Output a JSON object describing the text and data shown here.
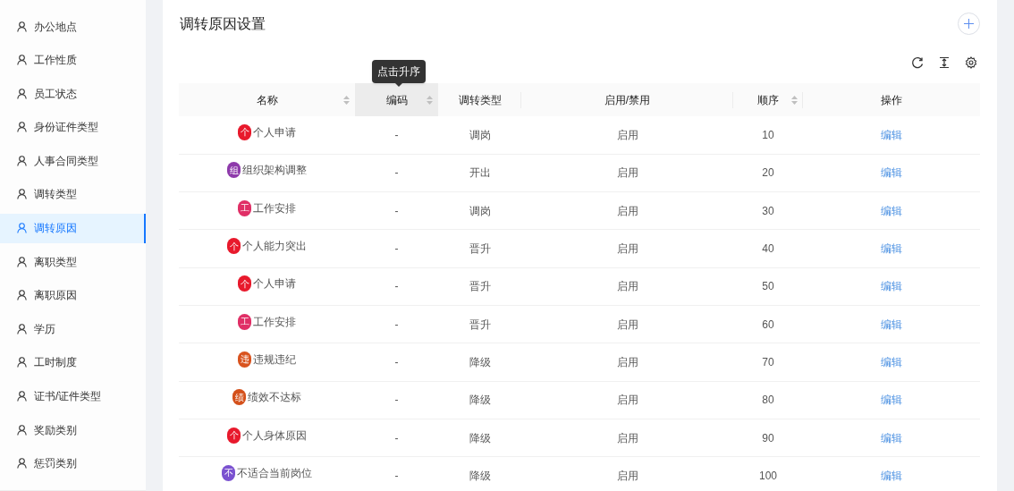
{
  "sidebar": {
    "items": [
      {
        "label": "办公地点",
        "selected": false
      },
      {
        "label": "工作性质",
        "selected": false
      },
      {
        "label": "员工状态",
        "selected": false
      },
      {
        "label": "身份证件类型",
        "selected": false
      },
      {
        "label": "人事合同类型",
        "selected": false
      },
      {
        "label": "调转类型",
        "selected": false
      },
      {
        "label": "调转原因",
        "selected": true
      },
      {
        "label": "离职类型",
        "selected": false
      },
      {
        "label": "离职原因",
        "selected": false
      },
      {
        "label": "学历",
        "selected": false
      },
      {
        "label": "工时制度",
        "selected": false
      },
      {
        "label": "证书/证件类型",
        "selected": false
      },
      {
        "label": "奖励类别",
        "selected": false
      },
      {
        "label": "惩罚类别",
        "selected": false
      }
    ]
  },
  "page": {
    "title": "调转原因设置",
    "tooltip": "点击升序"
  },
  "table": {
    "columns": [
      {
        "label": "名称",
        "sortable": true,
        "highlighted": false
      },
      {
        "label": "编码",
        "sortable": true,
        "highlighted": true
      },
      {
        "label": "调转类型",
        "sortable": false,
        "highlighted": false
      },
      {
        "label": "启用/禁用",
        "sortable": false,
        "highlighted": false
      },
      {
        "label": "顺序",
        "sortable": true,
        "highlighted": false
      },
      {
        "label": "操作",
        "sortable": false,
        "highlighted": false
      }
    ],
    "rows": [
      {
        "badge": "个",
        "color": "#e8192c",
        "name": "个人申请",
        "code": "-",
        "type": "调岗",
        "status": "启用",
        "order": "10",
        "action": "编辑"
      },
      {
        "badge": "组",
        "color": "#8e3aab",
        "name": "组织架构调整",
        "code": "-",
        "type": "开出",
        "status": "启用",
        "order": "20",
        "action": "编辑"
      },
      {
        "badge": "工",
        "color": "#e02f66",
        "name": "工作安排",
        "code": "-",
        "type": "调岗",
        "status": "启用",
        "order": "30",
        "action": "编辑"
      },
      {
        "badge": "个",
        "color": "#e8192c",
        "name": "个人能力突出",
        "code": "-",
        "type": "晋升",
        "status": "启用",
        "order": "40",
        "action": "编辑"
      },
      {
        "badge": "个",
        "color": "#e8192c",
        "name": "个人申请",
        "code": "-",
        "type": "晋升",
        "status": "启用",
        "order": "50",
        "action": "编辑"
      },
      {
        "badge": "工",
        "color": "#e02f66",
        "name": "工作安排",
        "code": "-",
        "type": "晋升",
        "status": "启用",
        "order": "60",
        "action": "编辑"
      },
      {
        "badge": "违",
        "color": "#d9531e",
        "name": "违规违纪",
        "code": "-",
        "type": "降级",
        "status": "启用",
        "order": "70",
        "action": "编辑"
      },
      {
        "badge": "绩",
        "color": "#d4501a",
        "name": "绩效不达标",
        "code": "-",
        "type": "降级",
        "status": "启用",
        "order": "80",
        "action": "编辑"
      },
      {
        "badge": "个",
        "color": "#e8192c",
        "name": "个人身体原因",
        "code": "-",
        "type": "降级",
        "status": "启用",
        "order": "90",
        "action": "编辑"
      },
      {
        "badge": "不",
        "color": "#7b52d0",
        "name": "不适合当前岗位",
        "code": "-",
        "type": "降级",
        "status": "启用",
        "order": "100",
        "action": "编辑"
      }
    ]
  }
}
